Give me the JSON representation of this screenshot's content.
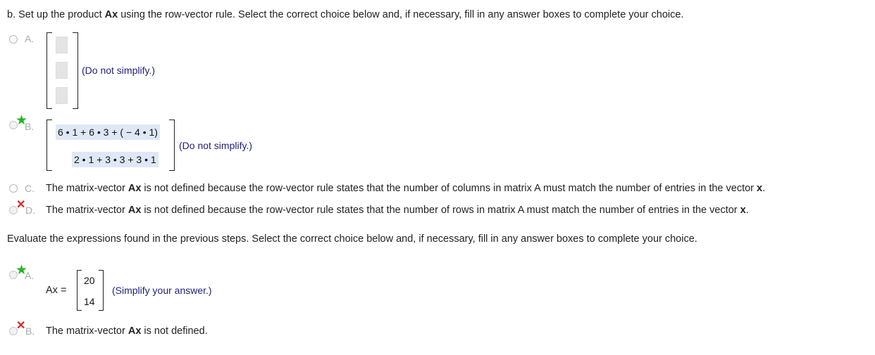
{
  "part_b": {
    "prompt_pre": "b. Set up the product ",
    "prompt_bold": "Ax",
    "prompt_post": " using the row-vector rule. Select the correct choice below and, if necessary, fill in any answer boxes to complete your choice."
  },
  "choices1": {
    "a_letter": "A.",
    "a_hint": "(Do not simplify.)",
    "b_letter": "B.",
    "b_row1": "6 • 1 + 6 • 3 + ( − 4 • 1)",
    "b_row2": "2 • 1 + 3 • 3 + 3 • 1",
    "b_hint": "(Do not simplify.)",
    "c_letter": "C.",
    "c_pre": "The matrix-vector ",
    "c_bold": "Ax",
    "c_mid": " is not defined because the row-vector rule states that the number of columns in matrix A must match the number of entries in the vector ",
    "c_end": "x",
    "c_dot": ".",
    "d_letter": "D.",
    "d_pre": "The matrix-vector ",
    "d_bold": "Ax",
    "d_mid": " is not defined because the row-vector rule states that the number of rows in matrix A must match the number of entries in the vector ",
    "d_end": "x",
    "d_dot": "."
  },
  "evaluate_prompt": "Evaluate the expressions found in the previous steps. Select the correct choice below and, if necessary, fill in any answer boxes to complete your choice.",
  "choices2": {
    "a_letter": "A.",
    "a_lhs": "Ax",
    "a_eq": " =",
    "a_val1": "20",
    "a_val2": "14",
    "a_hint": "(Simplify your answer.)",
    "b_letter": "B.",
    "b_pre": "The matrix-vector ",
    "b_bold": "Ax",
    "b_post": " is not defined."
  }
}
